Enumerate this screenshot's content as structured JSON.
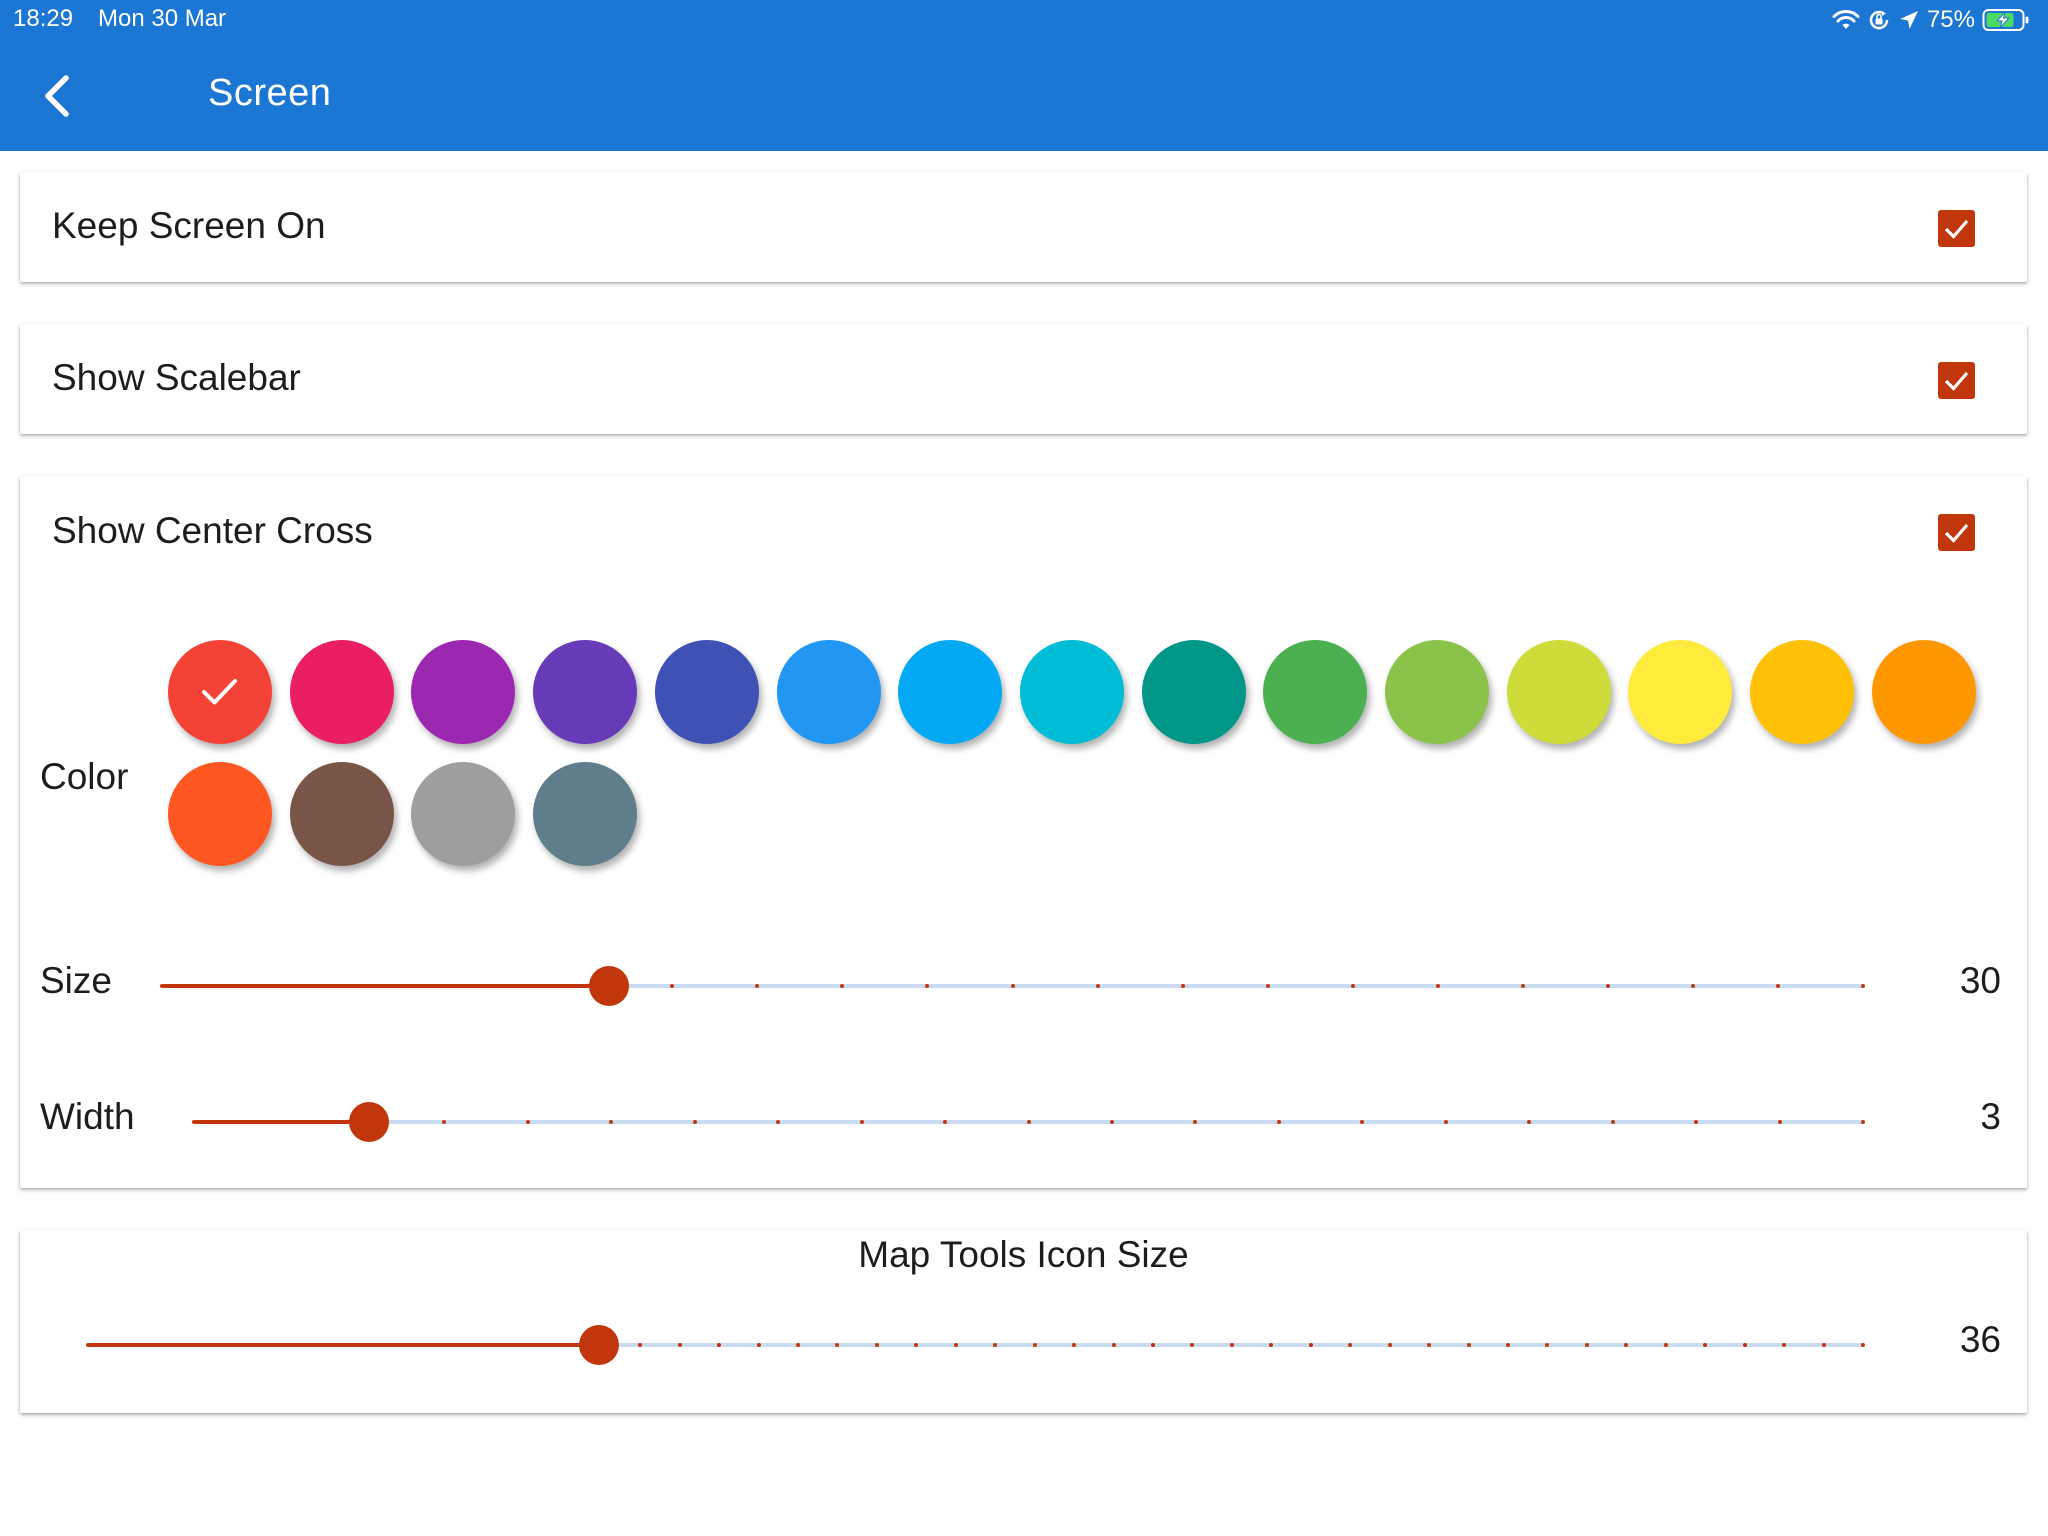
{
  "status_bar": {
    "time": "18:29",
    "date": "Mon 30 Mar",
    "battery": "75%",
    "icons": [
      "wifi-icon",
      "orientation-lock-icon",
      "location-arrow-icon",
      "battery-charging-icon"
    ]
  },
  "header": {
    "title": "Screen",
    "back_icon": "chevron-left-icon",
    "background": "#1b77d3"
  },
  "settings": {
    "keep_screen_on": {
      "label": "Keep Screen On",
      "checked": true
    },
    "show_scalebar": {
      "label": "Show Scalebar",
      "checked": true
    },
    "show_center_cross": {
      "label": "Show Center Cross",
      "checked": true,
      "color_label": "Color",
      "selected_color": "#f44336",
      "colors": [
        "#f44336",
        "#e91e63",
        "#9c27b0",
        "#673ab7",
        "#3f51b5",
        "#2196f3",
        "#03a9f4",
        "#00bcd4",
        "#009688",
        "#4caf50",
        "#8bc34a",
        "#cddc39",
        "#ffeb3b",
        "#ffc107",
        "#ff9800",
        "#ff5722",
        "#795548",
        "#9e9e9e",
        "#607d8b"
      ],
      "size": {
        "label": "Size",
        "value": "30",
        "fraction": 0.263,
        "ticks": 20
      },
      "width": {
        "label": "Width",
        "value": "3",
        "fraction": 0.105,
        "ticks": 20
      }
    },
    "map_tools_icon_size": {
      "label": "Map Tools Icon Size",
      "value": "36",
      "fraction": 0.288,
      "ticks": 45
    }
  },
  "accent_color": "#c2360e"
}
